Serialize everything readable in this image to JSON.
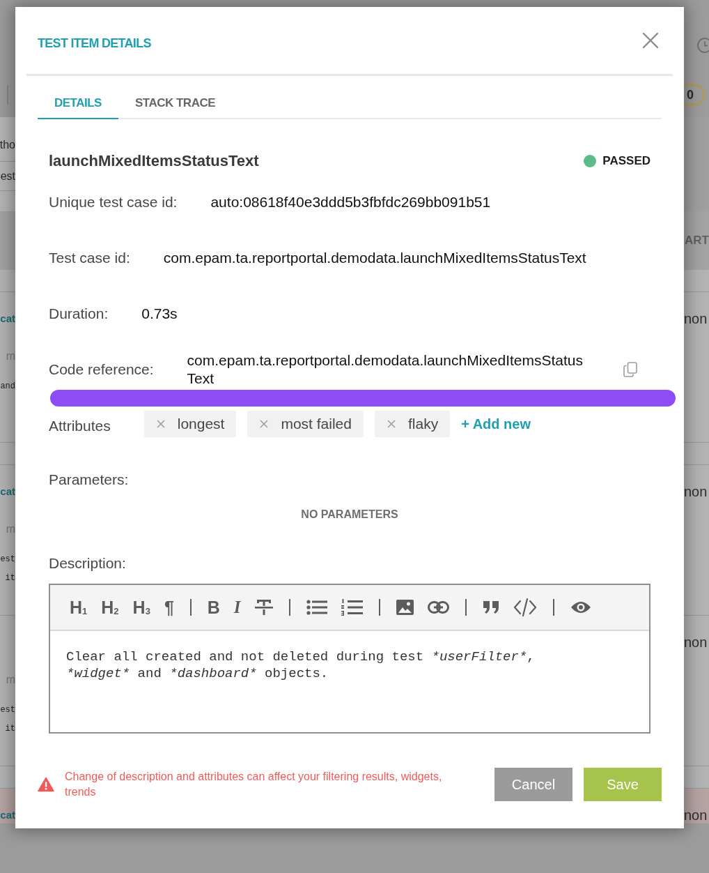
{
  "background_page": {
    "badge": "0",
    "filter_rows": [
      "tho",
      "est"
    ],
    "table_header_end": "ART",
    "row_groups": [
      [
        {
          "name": "cat",
          "meta": "m",
          "description": [
            "and"
          ],
          "last_column": "non",
          "highlighted": false
        }
      ],
      [
        {
          "name": "cat",
          "meta": "m",
          "description": [
            "est",
            "it"
          ],
          "last_column": "non",
          "highlighted": false
        },
        {
          "meta": "m",
          "description": [
            "est",
            "it"
          ],
          "last_column": "non",
          "highlighted": false
        }
      ],
      [
        {
          "name": "cat",
          "last_column": "non",
          "highlighted": true
        }
      ]
    ]
  },
  "modal": {
    "title": "TEST ITEM DETAILS",
    "tabs": [
      {
        "label": "DETAILS",
        "selected": true
      },
      {
        "label": "STACK TRACE",
        "selected": false
      }
    ],
    "item": {
      "name": "launchMixedItemsStatusText",
      "status": {
        "label": "PASSED",
        "kind": "passed"
      }
    },
    "fields": [
      {
        "label": "Unique test case id:",
        "value": "auto:08618f40e3ddd5b3fbfdc269bb091b51",
        "copy": false
      },
      {
        "label": "Test case id:",
        "value": "com.epam.ta.reportportal.demodata.launchMixedItemsStatusText",
        "copy": false
      },
      {
        "label": "Duration:",
        "value": "0.73s",
        "copy": false
      },
      {
        "label": "Code reference:",
        "value": "com.epam.ta.reportportal.demodata.launchMixedItemsStatusText",
        "copy": true
      }
    ],
    "attributes": {
      "label": "Attributes",
      "items": [
        "longest",
        "most failed",
        "flaky"
      ],
      "add_label": "+ Add new"
    },
    "parameters": {
      "label": "Parameters:",
      "empty_text": "NO PARAMETERS"
    },
    "description": {
      "label": "Description:",
      "toolbar": [
        [
          {
            "kind": "heading",
            "label": "H$_{1}$"
          },
          {
            "kind": "heading",
            "label": "H$_{2}$"
          },
          {
            "kind": "heading",
            "label": "H$_{3}$"
          },
          {
            "kind": "paragraph",
            "label": "¶"
          }
        ],
        [
          {
            "kind": "bold",
            "label": "B"
          },
          {
            "kind": "italic",
            "label": "I"
          },
          {
            "kind": "strikethrough"
          }
        ],
        [
          {
            "kind": "bullet-list"
          },
          {
            "kind": "numbered-list"
          }
        ],
        [
          {
            "kind": "image"
          },
          {
            "kind": "link"
          }
        ],
        [
          {
            "kind": "quote"
          },
          {
            "kind": "code"
          }
        ],
        [
          {
            "kind": "preview"
          }
        ]
      ],
      "lines": [
        [
          {
            "text": "Clear all created and not deleted during test ",
            "italic": false
          },
          {
            "text": "*userFilter*",
            "italic": true
          },
          {
            "text": ",",
            "italic": false
          }
        ],
        [
          {
            "text": "*widget*",
            "italic": true
          },
          {
            "text": " and ",
            "italic": false
          },
          {
            "text": "*dashboard*",
            "italic": true
          },
          {
            "text": " objects.",
            "italic": false
          }
        ]
      ]
    },
    "warning": "Change of description and attributes can affect your filtering results, widgets, trends",
    "buttons": [
      {
        "label": "Cancel",
        "kind": "secondary"
      },
      {
        "label": "Save",
        "kind": "primary"
      }
    ]
  }
}
